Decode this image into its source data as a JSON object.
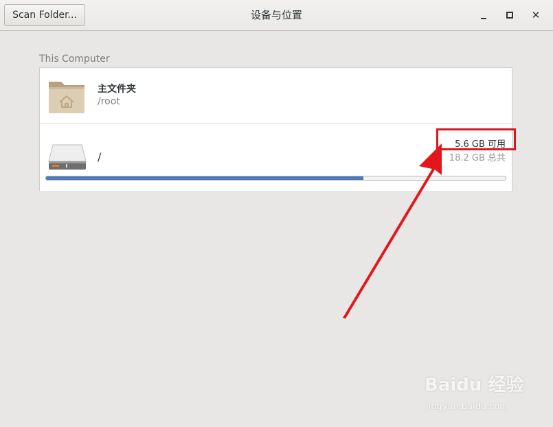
{
  "window": {
    "title": "设备与位置",
    "scan_button": "Scan Folder..."
  },
  "section_label": "This Computer",
  "items": [
    {
      "name": "主文件夹",
      "path": "/root",
      "icon": "home-folder-icon"
    },
    {
      "name": "/",
      "free": "5.6 GB 可用",
      "total": "18.2 GB 总共",
      "usage_fraction": 0.69,
      "icon": "hard-drive-icon"
    }
  ],
  "watermark": {
    "brand": "Baidu 经验",
    "url": "jingyan.baidu.com"
  },
  "colors": {
    "accent": "#4a7ab9",
    "highlight": "#d7171f"
  }
}
